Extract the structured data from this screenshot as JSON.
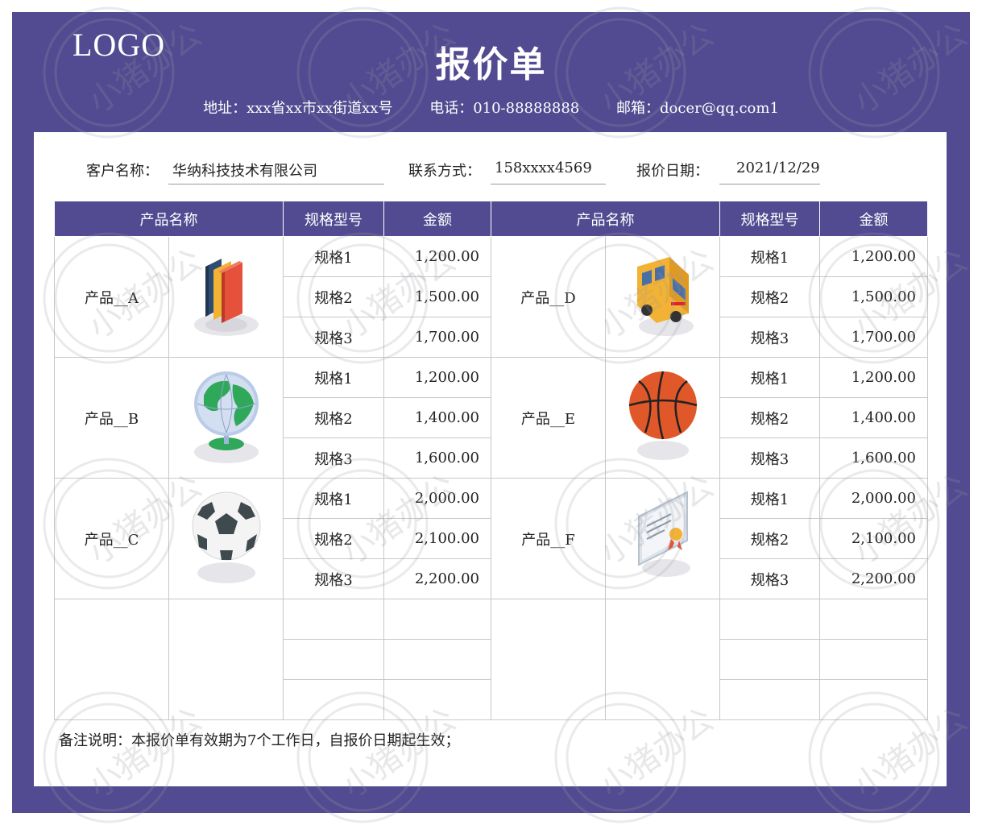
{
  "header": {
    "logo": "LOGO",
    "title": "报价单",
    "address": "地址：xxx省xx市xx街道xx号",
    "phone": "电话：010-88888888",
    "email": "邮箱：docer@qq.com1"
  },
  "info": {
    "customer_label": "客户名称：",
    "customer_value": "华纳科技技术有限公司",
    "contact_label": "联系方式：",
    "contact_value": "158xxxx4569",
    "date_label": "报价日期：",
    "date_value": "2021/12/29"
  },
  "table": {
    "headers": [
      "产品名称",
      "规格型号",
      "金额",
      "产品名称",
      "规格型号",
      "金额"
    ],
    "left": [
      {
        "name": "产品__A",
        "icon": "books-icon",
        "specs": [
          {
            "spec": "规格1",
            "amount": "1,200.00"
          },
          {
            "spec": "规格2",
            "amount": "1,500.00"
          },
          {
            "spec": "规格3",
            "amount": "1,700.00"
          }
        ]
      },
      {
        "name": "产品__B",
        "icon": "globe-icon",
        "specs": [
          {
            "spec": "规格1",
            "amount": "1,200.00"
          },
          {
            "spec": "规格2",
            "amount": "1,400.00"
          },
          {
            "spec": "规格3",
            "amount": "1,600.00"
          }
        ]
      },
      {
        "name": "产品__C",
        "icon": "soccer-ball-icon",
        "specs": [
          {
            "spec": "规格1",
            "amount": "2,000.00"
          },
          {
            "spec": "规格2",
            "amount": "2,100.00"
          },
          {
            "spec": "规格3",
            "amount": "2,200.00"
          }
        ]
      }
    ],
    "right": [
      {
        "name": "产品__D",
        "icon": "school-bus-icon",
        "specs": [
          {
            "spec": "规格1",
            "amount": "1,200.00"
          },
          {
            "spec": "规格2",
            "amount": "1,500.00"
          },
          {
            "spec": "规格3",
            "amount": "1,700.00"
          }
        ]
      },
      {
        "name": "产品__E",
        "icon": "basketball-icon",
        "specs": [
          {
            "spec": "规格1",
            "amount": "1,200.00"
          },
          {
            "spec": "规格2",
            "amount": "1,400.00"
          },
          {
            "spec": "规格3",
            "amount": "1,600.00"
          }
        ]
      },
      {
        "name": "产品__F",
        "icon": "certificate-icon",
        "specs": [
          {
            "spec": "规格1",
            "amount": "2,000.00"
          },
          {
            "spec": "规格2",
            "amount": "2,100.00"
          },
          {
            "spec": "规格3",
            "amount": "2,200.00"
          }
        ]
      }
    ]
  },
  "note": "备注说明：本报价单有效期为7个工作日，自报价日期起生效；",
  "watermark": "小猪办公",
  "colors": {
    "frame": "#524b91",
    "header_bg": "#524b91",
    "grid": "#c8c8c8"
  }
}
